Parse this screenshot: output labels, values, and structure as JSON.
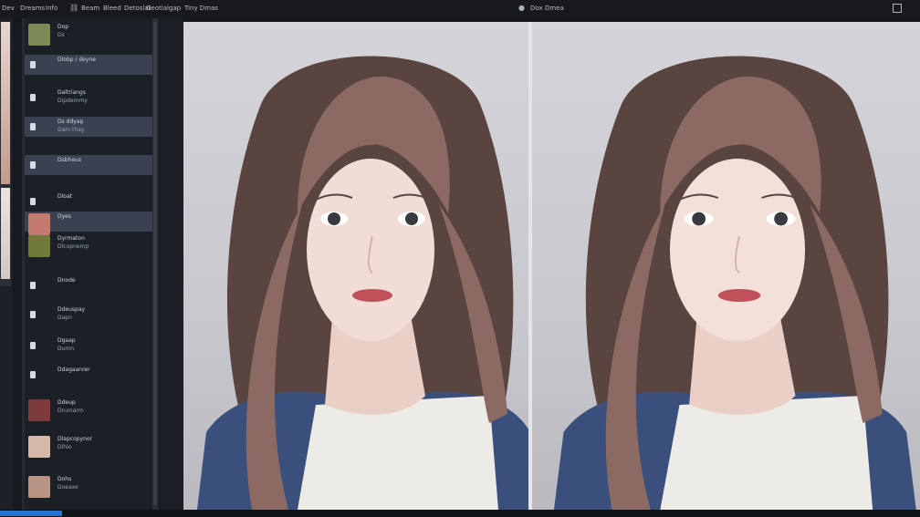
{
  "menu": {
    "items": [
      "Dev",
      "Dreams",
      "Info",
      "Beam",
      "Bleed",
      "Detoslat",
      "Geotialgap",
      "Tiny Dmas"
    ],
    "right_items": [
      "Dox",
      "Dmea"
    ]
  },
  "layers": [
    {
      "line1": "Dop",
      "line2": "Ds",
      "active": false,
      "kind": "thumb",
      "color": "#7b8a56"
    },
    {
      "line1": "Dlobp / deyne",
      "line2": "",
      "active": true,
      "kind": "dot"
    },
    {
      "line1": "Daltriangs",
      "line2": "Dipdemmy",
      "active": false,
      "kind": "dot"
    },
    {
      "line1": "Ds  ddyap",
      "line2": "Dam thay",
      "active": true,
      "kind": "dot"
    },
    {
      "line1": "Dsbheus",
      "line2": "",
      "active": true,
      "kind": "dot"
    },
    {
      "line1": "Dloat",
      "line2": "",
      "active": false,
      "kind": "dot"
    },
    {
      "line1": "Dyes",
      "line2": "",
      "active": true,
      "kind": "thumb",
      "color": "#c47a6e"
    },
    {
      "line1": "Dyrmaton",
      "line2": "Dlcopnemp",
      "active": false,
      "kind": "thumb",
      "color": "#6f7a3a"
    },
    {
      "line1": "Dnode",
      "line2": "",
      "active": false,
      "kind": "dot"
    },
    {
      "line1": "Ddeuspay",
      "line2": "Dapn",
      "active": false,
      "kind": "dot"
    },
    {
      "line1": "Dgaap",
      "line2": "Dumn",
      "active": false,
      "kind": "dot"
    },
    {
      "line1": "Ddagaanrer",
      "line2": "",
      "active": false,
      "kind": "dot"
    },
    {
      "line1": "Ddeup",
      "line2": "Drumarm",
      "active": false,
      "kind": "thumb",
      "color": "#7e3b3b"
    },
    {
      "line1": "Dlapcopynor",
      "line2": "Dlhlo",
      "active": false,
      "kind": "thumb",
      "color": "#d6b8a8"
    },
    {
      "line1": "Dohs",
      "line2": "Doeaxe",
      "active": false,
      "kind": "thumb",
      "color": "#b89484"
    }
  ],
  "views": [
    {
      "name": "before",
      "face_color": "#f2ddd6"
    },
    {
      "name": "after",
      "face_color": "#f3e0d9"
    }
  ],
  "colors": {
    "hair": "#5a4440",
    "hair_light": "#8a6a62",
    "sweater": "#3a4f7c",
    "top": "#ecebe6",
    "lips": "#c0505a"
  }
}
